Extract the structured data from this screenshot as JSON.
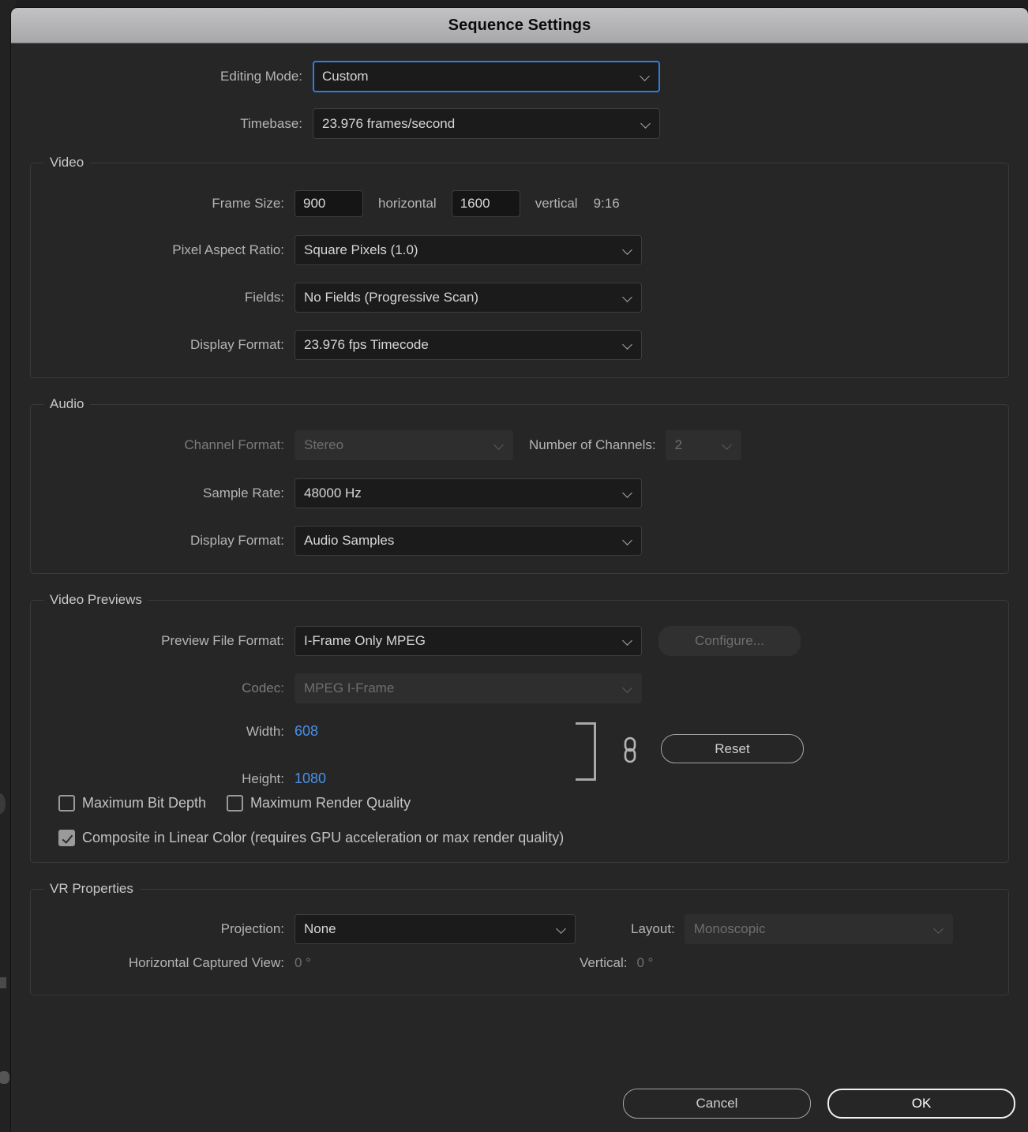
{
  "window": {
    "title": "Sequence Settings"
  },
  "top": {
    "editing_mode_label": "Editing Mode:",
    "editing_mode_value": "Custom",
    "timebase_label": "Timebase:",
    "timebase_value": "23.976  frames/second"
  },
  "video": {
    "legend": "Video",
    "frame_size_label": "Frame Size:",
    "frame_width": "900",
    "horizontal_label": "horizontal",
    "frame_height": "1600",
    "vertical_label": "vertical",
    "aspect_ratio_text": "9:16",
    "par_label": "Pixel Aspect Ratio:",
    "par_value": "Square Pixels (1.0)",
    "fields_label": "Fields:",
    "fields_value": "No Fields (Progressive Scan)",
    "display_format_label": "Display Format:",
    "display_format_value": "23.976 fps Timecode"
  },
  "audio": {
    "legend": "Audio",
    "channel_format_label": "Channel Format:",
    "channel_format_value": "Stereo",
    "num_channels_label": "Number of Channels:",
    "num_channels_value": "2",
    "sample_rate_label": "Sample Rate:",
    "sample_rate_value": "48000 Hz",
    "display_format_label": "Display Format:",
    "display_format_value": "Audio Samples"
  },
  "video_previews": {
    "legend": "Video Previews",
    "preview_format_label": "Preview File Format:",
    "preview_format_value": "I-Frame Only MPEG",
    "configure_label": "Configure...",
    "codec_label": "Codec:",
    "codec_value": "MPEG I-Frame",
    "width_label": "Width:",
    "width_value": "608",
    "height_label": "Height:",
    "height_value": "1080",
    "reset_label": "Reset",
    "max_bit_depth_label": "Maximum Bit Depth",
    "max_bit_depth_checked": false,
    "max_render_quality_label": "Maximum Render Quality",
    "max_render_quality_checked": false,
    "composite_linear_label": "Composite in Linear Color (requires GPU acceleration or max render quality)",
    "composite_linear_checked": true
  },
  "vr": {
    "legend": "VR Properties",
    "projection_label": "Projection:",
    "projection_value": "None",
    "layout_label": "Layout:",
    "layout_value": "Monoscopic",
    "horizontal_view_label": "Horizontal Captured View:",
    "horizontal_view_value": "0 °",
    "vertical_label": "Vertical:",
    "vertical_value": "0 °"
  },
  "footer": {
    "cancel_label": "Cancel",
    "ok_label": "OK"
  },
  "colors": {
    "accent_blue": "#4a90e8",
    "focus_blue": "#2f7ede",
    "dialog_bg": "#262626",
    "titlebar_bg": "#b0b0b3"
  }
}
